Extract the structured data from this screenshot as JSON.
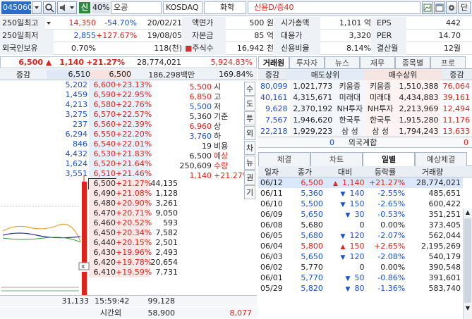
{
  "top": {
    "code": "045060",
    "badge": "신",
    "margin": "40%",
    "name": "오공",
    "market": "KOSDAQ",
    "sector": "화학",
    "credit": "신용D/증40",
    "last_btn": "단"
  },
  "info": {
    "rows": [
      [
        {
          "l": "250일최고",
          "v": "14,350",
          "v2": "-54.70%",
          "v3": "20/02/21",
          "l2": "액면가",
          "v4": "500 원",
          "l3": "시가총액",
          "v5": "1,101 억",
          "l4": "EPS",
          "v6": "442"
        }
      ],
      [
        {
          "l": "250일최저",
          "v": "2,855",
          "v2": "+127.67%",
          "v3": "19/08/05",
          "l2": "자본금",
          "v4": "85 억",
          "l3": "대용가",
          "v5": "3,320",
          "l4": "PER",
          "v6": "14.70"
        }
      ],
      [
        {
          "l": "외국인보유",
          "v": "0.70%",
          "v2": "",
          "v3": "118(천)",
          "l2": "주식수",
          "v4": "16,942 천",
          "l3": "신용비율",
          "v5": "8.14%",
          "l4": "결산월",
          "v6": "12월"
        }
      ]
    ]
  },
  "price": {
    "current": "6,500",
    "change": "1,140",
    "pct": "+21.27%",
    "volume": "28,774,021",
    "vol_ratio": "5,924.83%",
    "label_inc": "증감",
    "ask_total": "6,510",
    "bid_total": "6,500",
    "amount": "186,298백만",
    "rate": "169.84%"
  },
  "orderbook": {
    "asks": [
      {
        "qty": "5,202",
        "price": "6,600",
        "pct": "+23.13%"
      },
      {
        "qty": "1,459",
        "price": "6,590",
        "pct": "+22.95%"
      },
      {
        "qty": "4,213",
        "price": "6,580",
        "pct": "+22.76%"
      },
      {
        "qty": "3,275",
        "price": "6,570",
        "pct": "+22.57%"
      },
      {
        "qty": "237",
        "price": "6,560",
        "pct": "+22.39%"
      },
      {
        "qty": "6,294",
        "price": "6,550",
        "pct": "+22.20%"
      },
      {
        "qty": "846",
        "price": "6,540",
        "pct": "+22.01%"
      },
      {
        "qty": "4,432",
        "price": "6,530",
        "pct": "+21.83%"
      },
      {
        "qty": "1,624",
        "price": "6,520",
        "pct": "+21.64%"
      },
      {
        "qty": "3,551",
        "price": "6,510",
        "pct": "+21.46%"
      }
    ],
    "bids": [
      {
        "price": "6,500",
        "pct": "+21.27%",
        "qty": "44,135"
      },
      {
        "price": "6,490",
        "pct": "+21.08%",
        "qty": "1,128"
      },
      {
        "price": "6,480",
        "pct": "+20.90%",
        "qty": "3,261"
      },
      {
        "price": "6,470",
        "pct": "+20.71%",
        "qty": "9,050"
      },
      {
        "price": "6,460",
        "pct": "+20.52%",
        "qty": "593"
      },
      {
        "price": "6,450",
        "pct": "+20.34%",
        "qty": "7,582"
      },
      {
        "price": "6,440",
        "pct": "+20.15%",
        "qty": "2,501"
      },
      {
        "price": "6,430",
        "pct": "+19.96%",
        "qty": "2,493"
      },
      {
        "price": "6,420",
        "pct": "+19.78%",
        "qty": "20,654"
      },
      {
        "price": "6,410",
        "pct": "+19.59%",
        "qty": "7,731"
      }
    ],
    "stats": [
      {
        "v": "5,500",
        "l": "시"
      },
      {
        "v": "6,850",
        "l": "고"
      },
      {
        "v": "5,500",
        "l": "저"
      },
      {
        "v": "5,360",
        "l": "기준"
      },
      {
        "v": "6,960",
        "l": "상"
      },
      {
        "v": "3,760",
        "l": "하"
      },
      {
        "v": "19",
        "l": "비용"
      },
      {
        "v": "6,500",
        "l": "예상"
      },
      {
        "v": "250,609",
        "l": "수량"
      },
      {
        "v": "1,140",
        "l": "+21.27%"
      }
    ],
    "vtabs": [
      "수",
      "도",
      "투",
      "외",
      "차",
      "뉴",
      "권",
      "기"
    ],
    "bottom_total_ask": "31,133",
    "time": "15:59:42",
    "time_label": "시간외",
    "bottom_total_bid": "99,128",
    "after_1": "58,900",
    "after_2": "8,077"
  },
  "right": {
    "tabs": [
      "거래원",
      "투자자",
      "뉴스",
      "재무",
      "종목별",
      "프로"
    ],
    "broker_header": {
      "c1": "증감",
      "c2": "매도상위",
      "c3": "매수상위",
      "c4": "증감"
    },
    "brokers": [
      {
        "sq": "80,099",
        "sv": "1,021,773",
        "sn": "키움증",
        "bn": "키움증",
        "bv": "1,510,388",
        "bq": "76,064"
      },
      {
        "sq": "40,161",
        "sv": "4,315,671",
        "sn": "미래대",
        "bn": "미래대",
        "bv": "4,434,883",
        "bq": "39,161"
      },
      {
        "sq": "9,628",
        "sv": "2,370,192",
        "sn": "NH투자",
        "bn": "NH투자",
        "bv": "2,213,969",
        "bq": "12,494"
      },
      {
        "sq": "7,567",
        "sv": "1,946,620",
        "sn": "한국투",
        "bn": "한국투",
        "bv": "1,915,280",
        "bq": "11,176"
      },
      {
        "sq": "22,218",
        "sv": "1,929,223",
        "sn": "삼 성",
        "bn": "삼 성",
        "bv": "1,794,243",
        "bq": "13,633"
      }
    ],
    "foreign": {
      "l": "0",
      "label": "외국계합",
      "r": "0"
    },
    "tabs2": [
      "체결",
      "차트",
      "일별",
      "예상체결"
    ],
    "daily_header": {
      "date": "일자",
      "close": "종가",
      "diff": "대비",
      "rate": "등락률",
      "vol": "거래량"
    },
    "daily": [
      {
        "date": "06/12",
        "close": "6,500",
        "dir": "up",
        "diff": "1,140",
        "rate": "+21.27%",
        "vol": "28,774,021"
      },
      {
        "date": "06/11",
        "close": "5,360",
        "dir": "down",
        "diff": "140",
        "rate": "-2.55%",
        "vol": "485,651"
      },
      {
        "date": "06/10",
        "close": "5,500",
        "dir": "down",
        "diff": "150",
        "rate": "-2.65%",
        "vol": "600,422"
      },
      {
        "date": "06/09",
        "close": "5,650",
        "dir": "down",
        "diff": "30",
        "rate": "-0.53%",
        "vol": "351,251"
      },
      {
        "date": "06/08",
        "close": "5,680",
        "dir": "none",
        "diff": "0",
        "rate": "0.00%",
        "vol": "373,405"
      },
      {
        "date": "06/05",
        "close": "5,680",
        "dir": "down",
        "diff": "120",
        "rate": "-2.07%",
        "vol": "562,044"
      },
      {
        "date": "06/04",
        "close": "5,800",
        "dir": "up",
        "diff": "150",
        "rate": "+2.65%",
        "vol": "2,195,269"
      },
      {
        "date": "06/03",
        "close": "5,650",
        "dir": "down",
        "diff": "120",
        "rate": "-2.08%",
        "vol": "540,179"
      },
      {
        "date": "06/02",
        "close": "5,770",
        "dir": "none",
        "diff": "0",
        "rate": "0.00%",
        "vol": "390,548"
      },
      {
        "date": "06/01",
        "close": "5,770",
        "dir": "down",
        "diff": "50",
        "rate": "-0.86%",
        "vol": "391,601"
      },
      {
        "date": "05/29",
        "close": "5,820",
        "dir": "down",
        "diff": "80",
        "rate": "-1.36%",
        "vol": "583,740"
      }
    ]
  },
  "colors": {
    "up": "#e0231a",
    "down": "#1750d8",
    "ask_bg": "#e5f0fb",
    "bid_bg": "#fbe7e5",
    "sel": "#dbe8fb"
  }
}
